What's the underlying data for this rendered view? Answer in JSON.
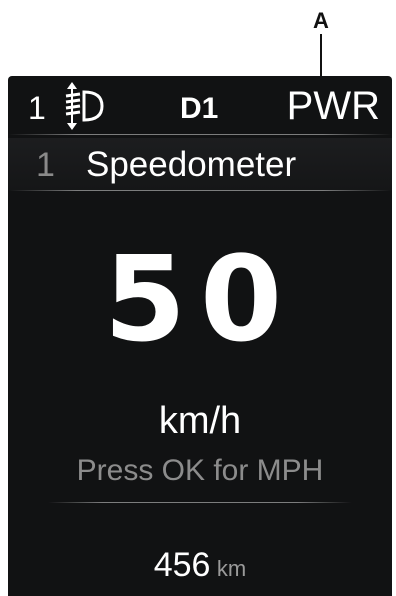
{
  "callout": {
    "label": "A"
  },
  "status_bar": {
    "headlamp_level": "1",
    "headlamp_icon": "headlamp-leveling-icon",
    "gear": "D1",
    "drive_mode": "PWR"
  },
  "menu": {
    "index": "1",
    "title": "Speedometer"
  },
  "speed": {
    "value": "50",
    "unit": "km/h",
    "hint": "Press OK for MPH"
  },
  "odometer": {
    "value": "456",
    "unit": "km"
  },
  "colors": {
    "screen_background": "#111213",
    "primary_text": "#ffffff",
    "secondary_text": "#8c8c8c"
  }
}
